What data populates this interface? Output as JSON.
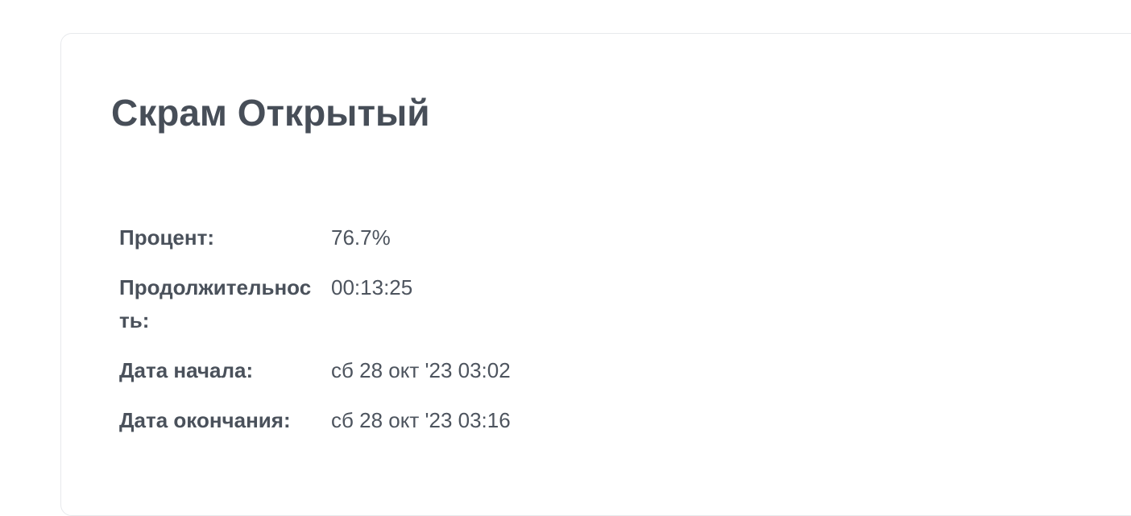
{
  "title": "Скрам Открытый",
  "details": [
    {
      "label": "Процент:",
      "value": "76.7%"
    },
    {
      "label": "Продолжительность:",
      "value": "00:13:25"
    },
    {
      "label": "Дата начала:",
      "value": "сб 28 окт '23 03:02"
    },
    {
      "label": "Дата окончания:",
      "value": "сб 28 окт '23 03:16"
    }
  ]
}
